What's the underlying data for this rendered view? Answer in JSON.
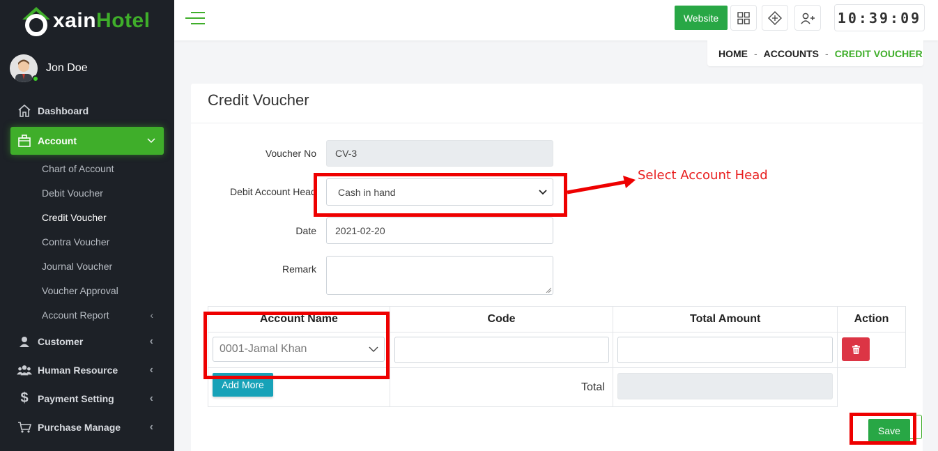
{
  "app": {
    "logo_prefix": "xain",
    "logo_suffix": "Hotel",
    "accent_color": "#3fae2a"
  },
  "user": {
    "name": "Jon Doe",
    "status": "online"
  },
  "sidebar": {
    "items": [
      {
        "label": "Dashboard",
        "icon": "home-icon"
      },
      {
        "label": "Account",
        "icon": "briefcase-icon",
        "active": true,
        "children": [
          {
            "label": "Chart of Account"
          },
          {
            "label": "Debit Voucher"
          },
          {
            "label": "Credit Voucher",
            "current": true
          },
          {
            "label": "Contra Voucher"
          },
          {
            "label": "Journal Voucher"
          },
          {
            "label": "Voucher Approval"
          },
          {
            "label": "Account Report",
            "has_children": true
          }
        ]
      },
      {
        "label": "Customer",
        "icon": "user-icon"
      },
      {
        "label": "Human Resource",
        "icon": "users-icon"
      },
      {
        "label": "Payment Setting",
        "icon": "dollar-icon"
      },
      {
        "label": "Purchase Manage",
        "icon": "cart-icon"
      }
    ]
  },
  "topbar": {
    "website_label": "Website",
    "clock": "10:39:09"
  },
  "breadcrumb": {
    "items": [
      "HOME",
      "ACCOUNTS",
      "CREDIT VOUCHER"
    ],
    "separator": "-"
  },
  "form": {
    "title": "Credit Voucher",
    "voucher_no": {
      "label": "Voucher No",
      "value": "CV-3"
    },
    "debit_account_head": {
      "label": "Debit Account Head",
      "value": "Cash in hand"
    },
    "date": {
      "label": "Date",
      "value": "2021-02-20"
    },
    "remark": {
      "label": "Remark",
      "value": ""
    }
  },
  "table": {
    "headers": [
      "Account Name",
      "Code",
      "Total Amount",
      "Action"
    ],
    "rows": [
      {
        "account_name": "0001-Jamal Khan",
        "code": "",
        "total_amount": ""
      }
    ],
    "add_more_label": "Add More",
    "total_label": "Total",
    "total_value": ""
  },
  "save_label": "Save",
  "annotation": {
    "text": "Select Account Head",
    "color": "#ee0000"
  }
}
